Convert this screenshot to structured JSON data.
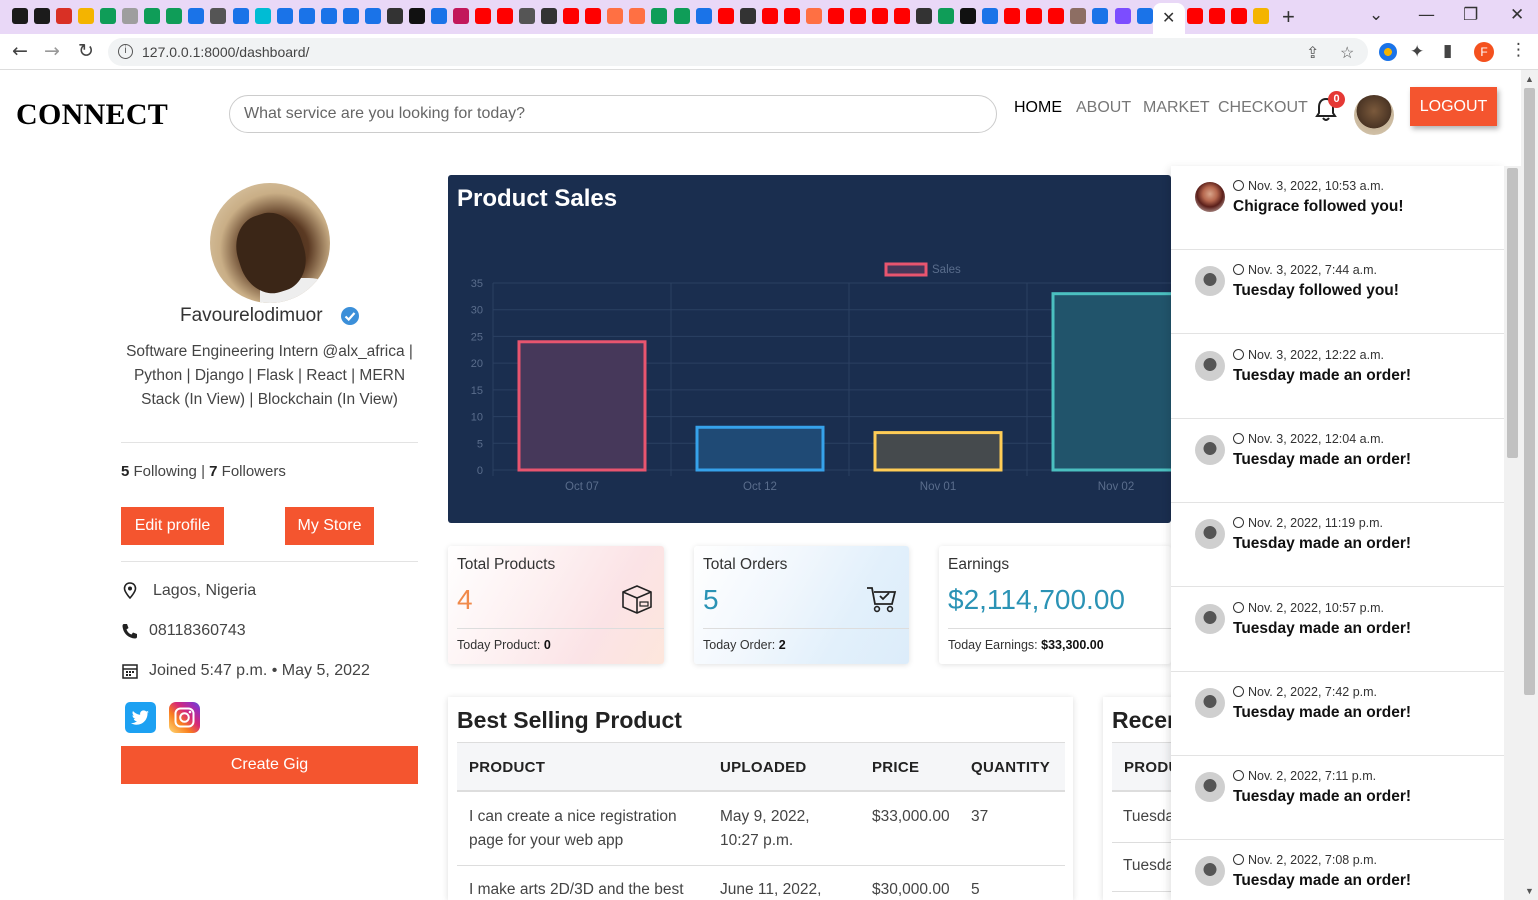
{
  "browser": {
    "url": "127.0.0.1:8000/dashboard/",
    "profile_initial": "F",
    "tab_colors": [
      "#1b1b1b",
      "#1b1b1b",
      "#d93025",
      "#f4b400",
      "#0f9d58",
      "#9e9e9e",
      "#0f9d58",
      "#0f9d58",
      "#1a73e8",
      "#555",
      "#1a73e8",
      "#00bcd4",
      "#1a73e8",
      "#1a73e8",
      "#1a73e8",
      "#1a73e8",
      "#1a73e8",
      "#333",
      "#111",
      "#1a73e8",
      "#c2185b",
      "#ff0000",
      "#ff0000",
      "#555",
      "#333",
      "#ff0000",
      "#ff0000",
      "#ff7043",
      "#ff7043",
      "#0f9d58",
      "#0f9d58",
      "#1a73e8",
      "#ff0000",
      "#333",
      "#ff0000",
      "#ff0000",
      "#ff7043",
      "#ff0000",
      "#ff0000",
      "#ff0000",
      "#ff0000",
      "#333",
      "#0f9d58",
      "#111",
      "#1a73e8",
      "#ff0000",
      "#ff0000",
      "#ff0000",
      "#8d6e63",
      "#1a73e8",
      "#7c4dff",
      "#1a73e8",
      "#333"
    ],
    "tail_tab_colors": [
      "#ff0000",
      "#ff0000",
      "#ff0000",
      "#f4b400"
    ]
  },
  "header": {
    "brand": "CONNECT",
    "search_placeholder": "What service are you looking for today?",
    "nav": [
      "HOME",
      "ABOUT",
      "MARKET",
      "CHECKOUT"
    ],
    "notification_count": "0",
    "logout": "LOGOUT",
    "accent_color": "#f4552f"
  },
  "profile": {
    "username": "Favourelodimuor",
    "bio": "Software Engineering Intern @alx_africa | Python | Django | Flask | React | MERN Stack (In View) | Blockchain (In View)",
    "following_count": "5",
    "following_label": "Following",
    "separator": "|",
    "followers_count": "7",
    "followers_label": "Followers",
    "edit_profile": "Edit profile",
    "my_store": "My Store",
    "location": "Lagos, Nigeria",
    "phone": "08118360743",
    "joined": "Joined 5:47 p.m. • May 5, 2022",
    "create_gig": "Create Gig"
  },
  "chart_data": {
    "type": "bar",
    "title": "Product Sales",
    "categories": [
      "Oct 07",
      "Oct 12",
      "Nov 01",
      "Nov 02"
    ],
    "series": [
      {
        "name": "Sales",
        "values": [
          24,
          8,
          7,
          33
        ]
      }
    ],
    "ylim": [
      0,
      35
    ],
    "yticks": [
      0,
      5,
      10,
      15,
      20,
      25,
      30,
      35
    ],
    "grid": true,
    "legend": "top-center",
    "bar_colors": [
      "#e8556f",
      "#36a2eb",
      "#ffcd56",
      "#4bc0c0"
    ],
    "bar_fills": [
      "#46385a",
      "#1f4a75",
      "#454a4d",
      "#21546b"
    ],
    "background": "#1a2e4f"
  },
  "stats": [
    {
      "label": "Total Products",
      "value": "4",
      "foot_label": "Today Product:",
      "foot_value": "0",
      "value_color": "#f08a4b"
    },
    {
      "label": "Total Orders",
      "value": "5",
      "foot_label": "Today Order:",
      "foot_value": "2",
      "value_color": "#2b93b5"
    },
    {
      "label": "Earnings",
      "value": "$2,114,700.00",
      "foot_label": "Today Earnings:",
      "foot_value": "$33,300.00",
      "value_color": "#2b93b5"
    }
  ],
  "best_selling": {
    "title": "Best Selling Product",
    "columns": [
      "PRODUCT",
      "UPLOADED",
      "PRICE",
      "QUANTITY"
    ],
    "rows": [
      {
        "product": "I can create a nice registration page for your web app",
        "uploaded": "May 9, 2022, 10:27 p.m.",
        "price": "$33,000.00",
        "quantity": "37"
      },
      {
        "product": "I make arts 2D/3D and the best",
        "uploaded": "June 11, 2022,",
        "price": "$30,000.00",
        "quantity": "5"
      }
    ]
  },
  "recent": {
    "title": "Recen",
    "column": "PRODU",
    "rows": [
      "Tuesda",
      "Tuesda"
    ]
  },
  "notifications": [
    {
      "time": "Nov. 3, 2022, 10:53 a.m.",
      "message": "Chigrace followed you!",
      "avatar": "girl"
    },
    {
      "time": "Nov. 3, 2022, 7:44 a.m.",
      "message": "Tuesday followed you!",
      "avatar": "cup"
    },
    {
      "time": "Nov. 3, 2022, 12:22 a.m.",
      "message": "Tuesday made an order!",
      "avatar": "cup"
    },
    {
      "time": "Nov. 3, 2022, 12:04 a.m.",
      "message": "Tuesday made an order!",
      "avatar": "cup"
    },
    {
      "time": "Nov. 2, 2022, 11:19 p.m.",
      "message": "Tuesday made an order!",
      "avatar": "cup"
    },
    {
      "time": "Nov. 2, 2022, 10:57 p.m.",
      "message": "Tuesday made an order!",
      "avatar": "cup"
    },
    {
      "time": "Nov. 2, 2022, 7:42 p.m.",
      "message": "Tuesday made an order!",
      "avatar": "cup"
    },
    {
      "time": "Nov. 2, 2022, 7:11 p.m.",
      "message": "Tuesday made an order!",
      "avatar": "cup"
    },
    {
      "time": "Nov. 2, 2022, 7:08 p.m.",
      "message": "Tuesday made an order!",
      "avatar": "cup"
    }
  ]
}
